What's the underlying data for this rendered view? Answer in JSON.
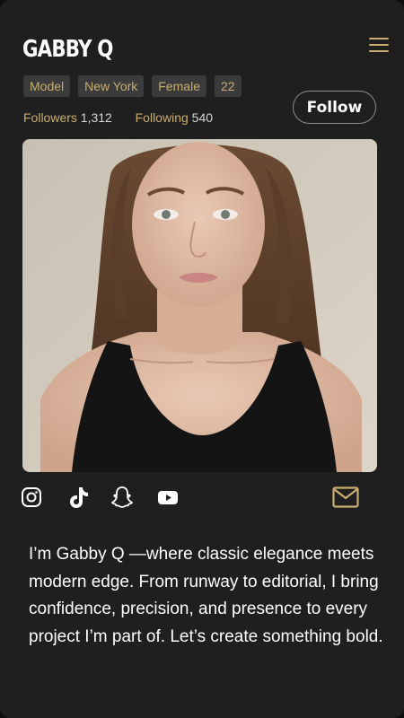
{
  "profile": {
    "name": "GABBY Q",
    "tags": [
      "Model",
      "New York",
      "Female",
      "22"
    ],
    "followers_label": "Followers",
    "followers_count": "1,312",
    "following_label": "Following",
    "following_count": "540",
    "follow_label": "Follow"
  },
  "photo": {
    "icon": "portrait-photo"
  },
  "social": {
    "icons": [
      "instagram-icon",
      "tiktok-icon",
      "snapchat-icon",
      "youtube-icon"
    ],
    "message_icon": "mail-icon"
  },
  "bio": "I’m Gabby Q —where classic elegance meets modern edge. From runway to editorial, I bring confidence, precision, and presence to every project I’m part of. Let’s create something bold.",
  "colors": {
    "background": "#1f1f1f",
    "accent": "#c9ad70",
    "tag_bg": "#3b3b3b",
    "text": "#ffffff"
  }
}
